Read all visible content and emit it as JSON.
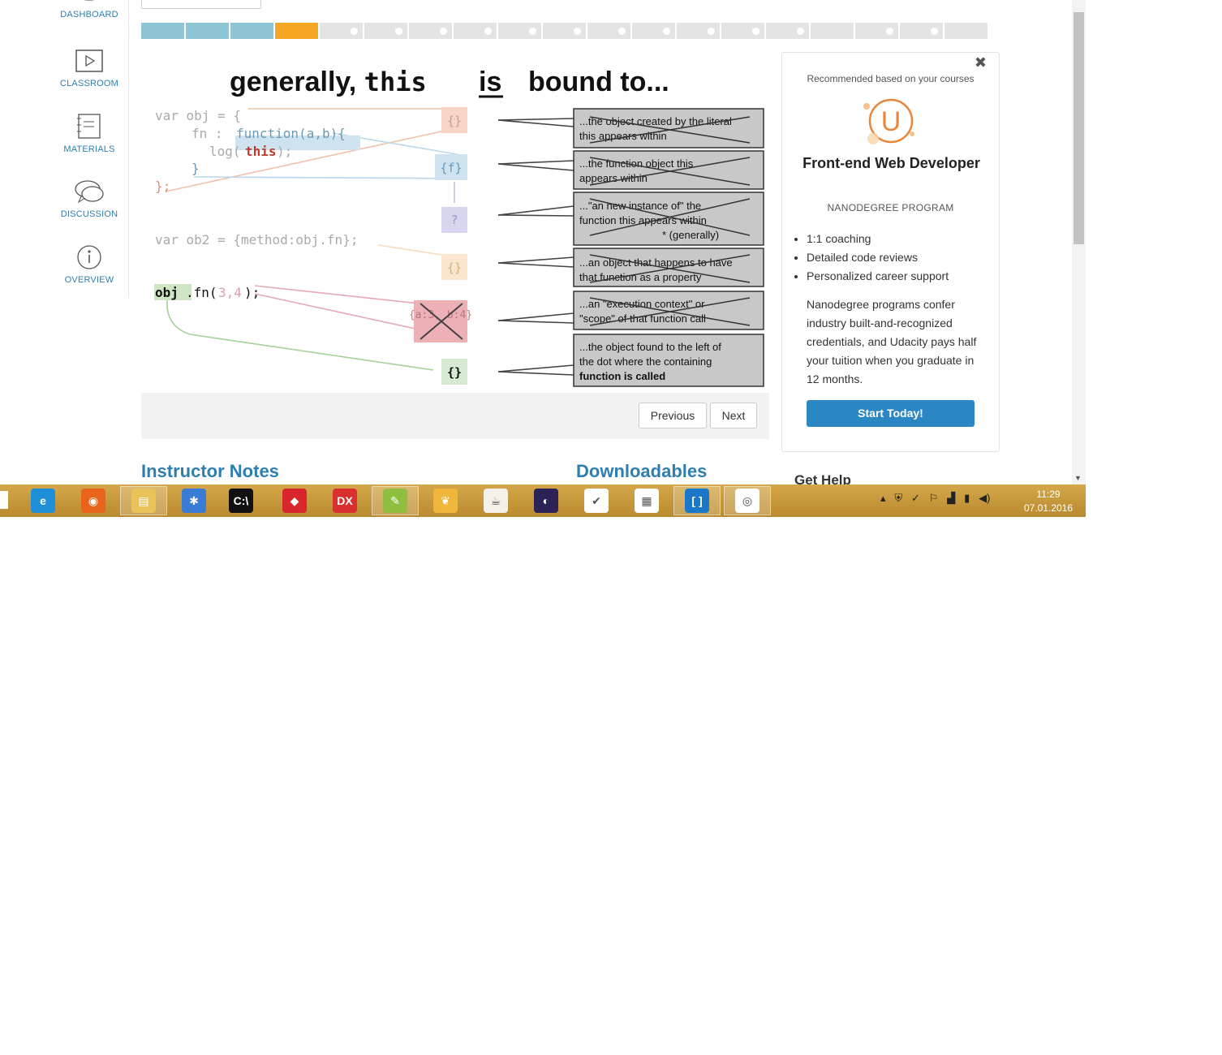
{
  "nav": {
    "dashboard": "DASHBOARD",
    "classroom": "CLASSROOM",
    "materials": "MATERIALS",
    "discussion": "DISCUSSION",
    "overview": "OVERVIEW"
  },
  "progress": {
    "total": 19,
    "completed": 3,
    "current": 4
  },
  "video": {
    "title_a": "generally, ",
    "title_this": "this",
    "title_is": "is",
    "title_b": "bound to...",
    "code": {
      "l1": "var obj = {",
      "l2a": "fn : ",
      "l2b": "function(a,b){",
      "l3a": "log(",
      "l3b": "this",
      "l3c": ");",
      "l4": "}",
      "l5": "};",
      "l6": "var ob2 = {method:obj.fn};",
      "l7a": "obj",
      "l7b": ".fn(",
      "l7c": "3,4",
      "l7d": ");"
    },
    "boxes": {
      "b1": "{}",
      "b2": "{f}",
      "b3": "?",
      "b4": "{}",
      "b5": "{a:3, b:4}",
      "b6": "{}"
    },
    "callouts": [
      {
        "t1": "...the object created by the literal",
        "t2": "this appears within"
      },
      {
        "t1": "...the function object this",
        "t2": "appears within"
      },
      {
        "t1": "...\"an new instance of\" the",
        "t2": "function this appears within",
        "t3": "* (generally)"
      },
      {
        "t1": "...an object that happens to have",
        "t2": "that function as a property"
      },
      {
        "t1": "...an \"execution context\" or",
        "t2": "\"scope\" of that function call"
      },
      {
        "t1": "...the object found to the left of",
        "t2": "the dot where the containing",
        "t3": "function is called"
      }
    ]
  },
  "controls": {
    "previous": "Previous",
    "next": "Next"
  },
  "sections": {
    "notes": "Instructor Notes",
    "downloads": "Downloadables",
    "help": "Get Help"
  },
  "card": {
    "close": "✖",
    "recommended": "Recommended based on your courses",
    "logo": "U",
    "title": "Front-end Web Developer",
    "subtitle": "NANODEGREE PROGRAM",
    "bullets": [
      "1:1 coaching",
      "Detailed code reviews",
      "Personalized career support"
    ],
    "description": "Nanodegree programs confer industry built-and-recognized credentials, and Udacity pays half your tuition when you graduate in 12 months.",
    "cta": "Start Today!"
  },
  "taskbar": {
    "apps": [
      {
        "name": "internet-explorer",
        "color": "#1f8fd8",
        "glyph": "e"
      },
      {
        "name": "firefox",
        "color": "#e8641b",
        "glyph": "◉"
      },
      {
        "name": "file-explorer",
        "color": "#e9c25a",
        "glyph": "▤"
      },
      {
        "name": "bug-tool",
        "color": "#3a7bd5",
        "glyph": "✱"
      },
      {
        "name": "command-prompt",
        "color": "#111111",
        "glyph": "C:\\"
      },
      {
        "name": "dart-app",
        "color": "#d9262c",
        "glyph": "◆"
      },
      {
        "name": "devexpress",
        "color": "#d92f2f",
        "glyph": "DX"
      },
      {
        "name": "notepad-plus",
        "color": "#8fbf3f",
        "glyph": "✎"
      },
      {
        "name": "plants-app",
        "color": "#f0b53b",
        "glyph": "❦"
      },
      {
        "name": "java-app",
        "color": "#f4f1e8",
        "glyph": "☕"
      },
      {
        "name": "eclipse",
        "color": "#2c2255",
        "glyph": "◐"
      },
      {
        "name": "todo-app",
        "color": "#ffffff",
        "glyph": "✔"
      },
      {
        "name": "grid-app",
        "color": "#ffffff",
        "glyph": "▦"
      },
      {
        "name": "brackets",
        "color": "#1a77c9",
        "glyph": "[ ]"
      },
      {
        "name": "chrome",
        "color": "#ffffff",
        "glyph": "◎"
      }
    ],
    "time": "11:29",
    "date": "07.01.2016"
  },
  "colors": {
    "accent": "#2e7fb0",
    "progress_done": "#8ec6d6",
    "progress_current": "#f5a623",
    "cta": "#2a87c4",
    "logo": "#e8873a"
  }
}
